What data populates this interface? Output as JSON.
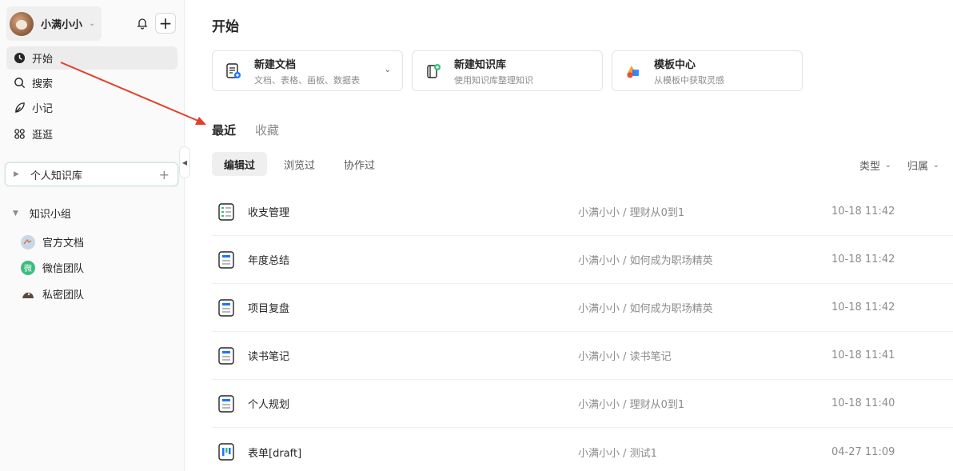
{
  "sidebar": {
    "user_name": "小满小小",
    "nav": [
      {
        "label": "开始",
        "icon": "clock-icon"
      },
      {
        "label": "搜索",
        "icon": "search-icon"
      },
      {
        "label": "小记",
        "icon": "feather-icon"
      },
      {
        "label": "逛逛",
        "icon": "grid-icon"
      }
    ],
    "knowledge_base": "个人知识库",
    "group_title": "知识小组",
    "groups": [
      {
        "label": "官方文档",
        "icon": "team-avatar-icon"
      },
      {
        "label": "微信团队",
        "icon": "wechat-avatar-icon",
        "badge": "微"
      },
      {
        "label": "私密团队",
        "icon": "private-team-icon"
      }
    ]
  },
  "main": {
    "title": "开始",
    "cards": [
      {
        "title": "新建文档",
        "sub": "文档、表格、画板、数据表",
        "icon": "new-doc-icon"
      },
      {
        "title": "新建知识库",
        "sub": "使用知识库整理知识",
        "icon": "new-kb-icon"
      },
      {
        "title": "模板中心",
        "sub": "从模板中获取灵感",
        "icon": "template-icon"
      }
    ],
    "tabs": [
      "最近",
      "收藏"
    ],
    "filters": [
      "编辑过",
      "浏览过",
      "协作过"
    ],
    "sort": {
      "type": "类型",
      "belong": "归属"
    },
    "rows": [
      {
        "title": "收支管理",
        "path": "小满小小 / 理财从0到1",
        "time": "10-18 11:42",
        "icon": "sheet-icon"
      },
      {
        "title": "年度总结",
        "path": "小满小小 / 如何成为职场精英",
        "time": "10-18 11:42",
        "icon": "doc-icon"
      },
      {
        "title": "项目复盘",
        "path": "小满小小 / 如何成为职场精英",
        "time": "10-18 11:42",
        "icon": "doc-icon"
      },
      {
        "title": "读书笔记",
        "path": "小满小小 / 读书笔记",
        "time": "10-18 11:41",
        "icon": "doc-icon"
      },
      {
        "title": "个人规划",
        "path": "小满小小 / 理财从0到1",
        "time": "10-18 11:40",
        "icon": "doc-icon"
      },
      {
        "title": "表单[draft]",
        "path": "小满小小 / 测试1",
        "time": "04-27 11:09",
        "icon": "form-icon"
      }
    ]
  },
  "colors": {
    "accent": "#1677ff",
    "annotation_arrow": "#e0402b",
    "green": "#3dbd7d"
  }
}
